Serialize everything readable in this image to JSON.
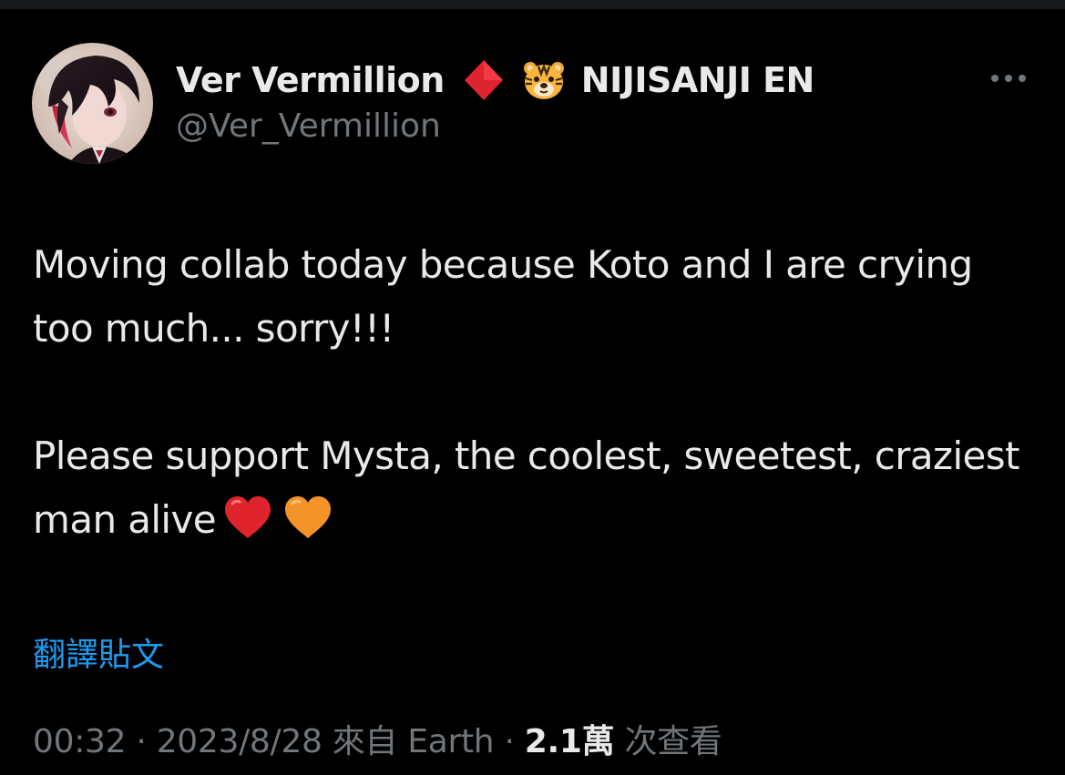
{
  "colors": {
    "background": "#000000",
    "primary_text": "#e7e9ea",
    "secondary_text": "#71767b",
    "link": "#1d9bf0",
    "diamond": "#e0242e",
    "heart_red": "#e0242e",
    "heart_orange": "#f4932a"
  },
  "author": {
    "display_name": "Ver Vermillion",
    "badge_icon": "red-diamond-icon",
    "affiliation_icon": "tiger-face-icon",
    "affiliation": "NIJISANJI EN",
    "handle": "@Ver_Vermillion",
    "avatar_icon": "profile-avatar"
  },
  "menu": {
    "icon": "more-horizontal-icon"
  },
  "tweet": {
    "paragraph_1": "Moving collab today because Koto and I are crying too much... sorry!!!",
    "paragraph_2": "Please support Mysta, the coolest, sweetest, craziest man alive",
    "emoji": [
      "red-heart-icon",
      "orange-heart-icon"
    ]
  },
  "translate": {
    "label": "翻譯貼文"
  },
  "meta": {
    "time": "00:32",
    "separator_1": " · ",
    "date": "2023/8/28",
    "source_prefix": " 來自 ",
    "source": "Earth",
    "separator_2": " · ",
    "views_count": "2.1萬",
    "views_label": " 次查看"
  }
}
